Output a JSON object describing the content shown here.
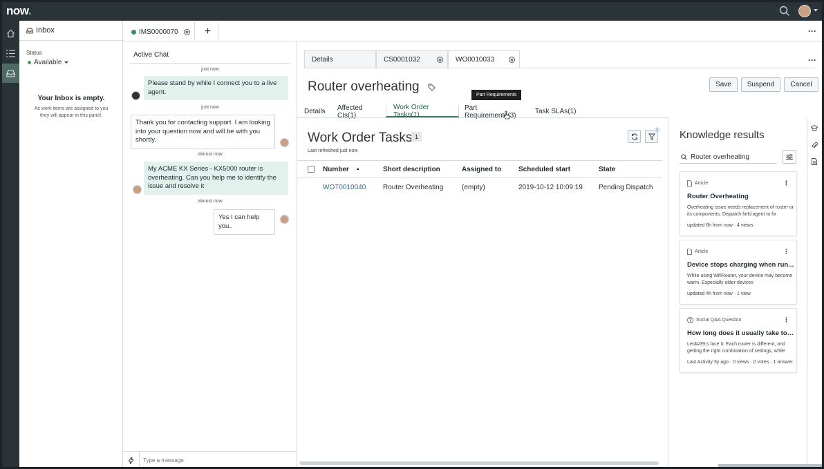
{
  "header": {
    "logo_text": "now",
    "logo_dot": "."
  },
  "inbox": {
    "title": "Inbox",
    "status_label": "Status",
    "status_value": "Available",
    "empty_title": "Your Inbox is empty.",
    "empty_desc": "As work items are assigned to you they will appear in this panel."
  },
  "workspace_tabs": [
    {
      "label": "IMS0000070"
    }
  ],
  "chat": {
    "title": "Active Chat",
    "messages": [
      {
        "time": "just now",
        "text": "Please stand by while I connect you to a live agent.",
        "from": "agent"
      },
      {
        "time": "just now",
        "text": "Thank you for contacting support. I am looking into your question now and will be with you shortly.",
        "from": "me"
      },
      {
        "time": "almost now",
        "text": "My ACME KX Series - KX5000 router is overheating. Can you help me to identify the issue and resolve it",
        "from": "agent"
      },
      {
        "time": "almost now",
        "text": "Yes I can help you..",
        "from": "me"
      }
    ],
    "input_placeholder": "Type a message"
  },
  "record_tabs": [
    {
      "label": "Details"
    },
    {
      "label": "CS0001032"
    },
    {
      "label": "WO0010033"
    }
  ],
  "record": {
    "title": "Router overheating",
    "tooltip": "Part Requirements",
    "buttons": {
      "save": "Save",
      "suspend": "Suspend",
      "cancel": "Cancel"
    },
    "related_tabs": [
      "Details",
      "Affected CIs(1)",
      "Work Order Tasks(1)",
      "Part Requirements(3)",
      "Task SLAs(1)"
    ]
  },
  "work_order_tasks": {
    "title": "Work Order Tasks",
    "count": "1",
    "refreshed": "Last refreshed just now",
    "filter_badge": "1",
    "columns": [
      "Number",
      "Short description",
      "Assigned to",
      "Scheduled start",
      "State"
    ],
    "rows": [
      {
        "number": "WOT0010040",
        "short_description": "Router Overheating",
        "assigned_to": "(empty)",
        "scheduled_start": "2019-10-12 10:09:19",
        "state": "Pending Dispatch"
      }
    ]
  },
  "knowledge": {
    "title": "Knowledge results",
    "search_value": "Router overheating",
    "cards": [
      {
        "type": "Article",
        "title": "Router Overheating",
        "desc": "Overheating issue needs replacement of router or its components. Dispatch field agent to fix",
        "meta": "updated 6h from now · 4 views",
        "icon": "document-icon"
      },
      {
        "type": "Article",
        "title": "Device stops charging when run...",
        "desc": "While using WifiRouter, your device may become warm. Especially older devices",
        "meta": "updated 4h from now · 1 view",
        "icon": "document-icon"
      },
      {
        "type": "Social Q&A Question",
        "title": "How long does it usually take to ...",
        "desc": "Let&#39;s face it: Each router is different, and getting the right combination of settings, while",
        "meta": "Last Activity 3y ago · 0 views · 0 votes · 1 answer",
        "icon": "question-icon"
      }
    ]
  },
  "colors": {
    "topbar": "#2a3338",
    "accent": "#3b7c63",
    "link": "#2e6f8e",
    "chat_bubble": "#e2f1ec"
  }
}
